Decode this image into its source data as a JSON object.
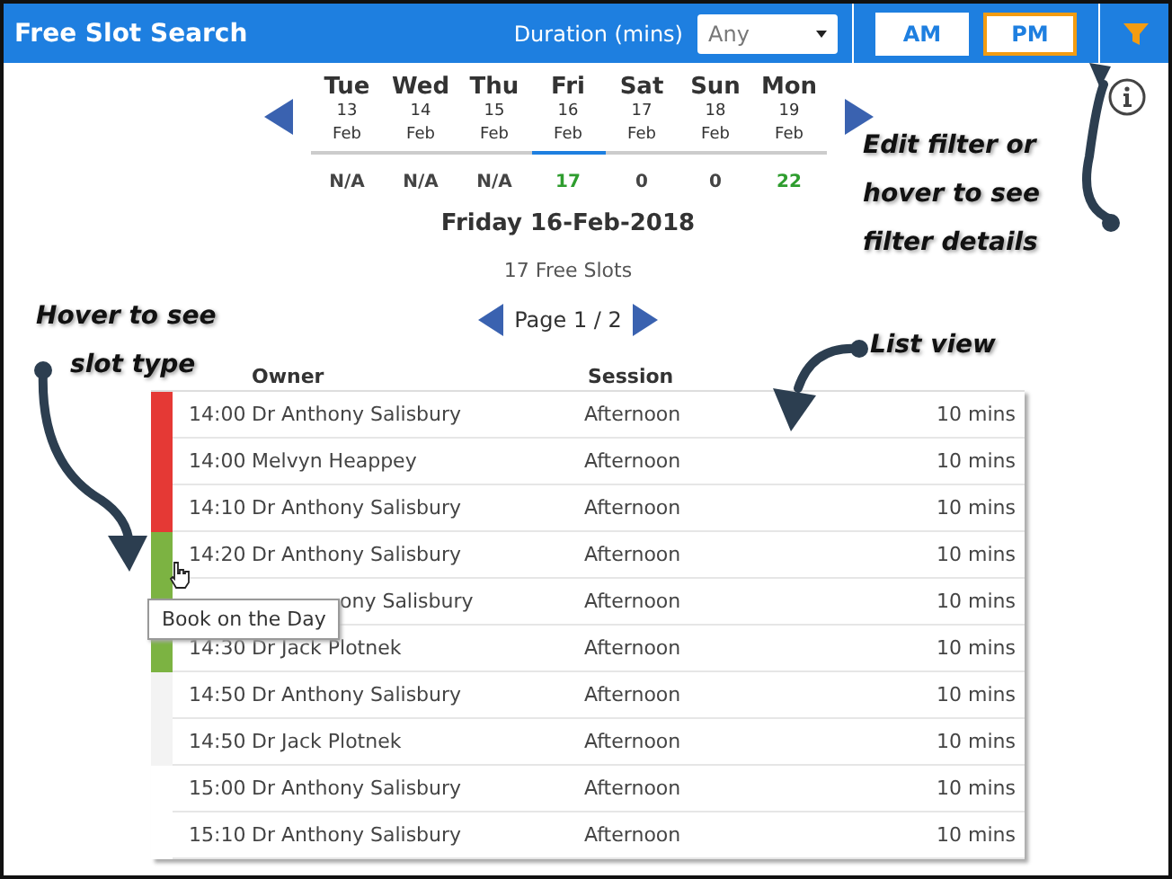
{
  "header": {
    "title": "Free Slot Search",
    "duration_label": "Duration (mins)",
    "duration_value": "Any",
    "sessions": [
      {
        "label": "AM",
        "selected": false
      },
      {
        "label": "PM",
        "selected": true
      }
    ]
  },
  "days": [
    {
      "day": "Tue",
      "date": "13",
      "month": "Feb",
      "count": "N/A",
      "available": false,
      "selected": false
    },
    {
      "day": "Wed",
      "date": "14",
      "month": "Feb",
      "count": "N/A",
      "available": false,
      "selected": false
    },
    {
      "day": "Thu",
      "date": "15",
      "month": "Feb",
      "count": "N/A",
      "available": false,
      "selected": false
    },
    {
      "day": "Fri",
      "date": "16",
      "month": "Feb",
      "count": "17",
      "available": true,
      "selected": true
    },
    {
      "day": "Sat",
      "date": "17",
      "month": "Feb",
      "count": "0",
      "available": false,
      "selected": false
    },
    {
      "day": "Sun",
      "date": "18",
      "month": "Feb",
      "count": "0",
      "available": false,
      "selected": false
    },
    {
      "day": "Mon",
      "date": "19",
      "month": "Feb",
      "count": "22",
      "available": true,
      "selected": false
    }
  ],
  "selected_date": "Friday 16-Feb-2018",
  "free_slots": "17 Free Slots",
  "page": "Page 1 / 2",
  "table": {
    "columns": [
      "Owner",
      "Session"
    ],
    "rows": [
      {
        "time": "14:00",
        "owner": "Dr Anthony Salisbury",
        "session": "Afternoon",
        "duration": "10 mins",
        "color": "#e53935"
      },
      {
        "time": "14:00",
        "owner": "Melvyn Heappey",
        "session": "Afternoon",
        "duration": "10 mins",
        "color": "#e53935"
      },
      {
        "time": "14:10",
        "owner": "Dr Anthony Salisbury",
        "session": "Afternoon",
        "duration": "10 mins",
        "color": "#e53935"
      },
      {
        "time": "14:20",
        "owner": "Dr Anthony Salisbury",
        "session": "Afternoon",
        "duration": "10 mins",
        "color": "#7cb342"
      },
      {
        "owner": "ony Salisbury",
        "session": "Afternoon",
        "duration": "10 mins",
        "color": "#7cb342"
      },
      {
        "time": "14:30",
        "owner": "Dr Jack Plotnek",
        "session": "Afternoon",
        "duration": "10 mins",
        "color": "#7cb342"
      },
      {
        "time": "14:50",
        "owner": "Dr Anthony Salisbury",
        "session": "Afternoon",
        "duration": "10 mins",
        "color": "#f3f3f3"
      },
      {
        "time": "14:50",
        "owner": "Dr Jack Plotnek",
        "session": "Afternoon",
        "duration": "10 mins",
        "color": "#f3f3f3"
      },
      {
        "time": "15:00",
        "owner": "Dr Anthony Salisbury",
        "session": "Afternoon",
        "duration": "10 mins",
        "color": "#ffffff"
      },
      {
        "time": "15:10",
        "owner": "Dr Anthony Salisbury",
        "session": "Afternoon",
        "duration": "10 mins",
        "color": "#ffffff"
      }
    ]
  },
  "tooltip": "Book on the Day",
  "annotations": [
    [
      "Edit filter or",
      "hover to see",
      "filter details"
    ],
    [
      "List view"
    ],
    [
      "Hover to see",
      "slot type"
    ]
  ]
}
